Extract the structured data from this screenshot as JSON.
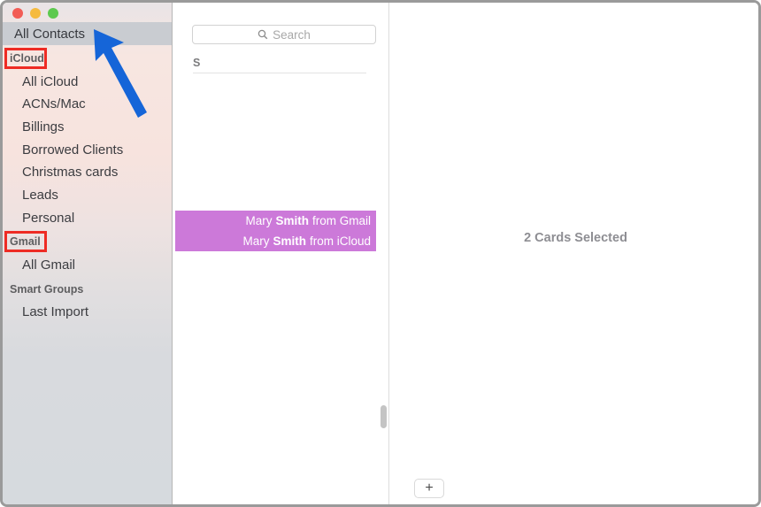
{
  "window": {
    "traffic_lights": [
      {
        "name": "close",
        "color": "#f25c55"
      },
      {
        "name": "minimize",
        "color": "#f5ba3f"
      },
      {
        "name": "zoom",
        "color": "#5ec94f"
      }
    ]
  },
  "sidebar": {
    "all_contacts": {
      "label": "All Contacts",
      "selected": true
    },
    "groups": [
      {
        "header": "iCloud",
        "header_annotated": true,
        "items": [
          {
            "label": "All iCloud"
          },
          {
            "label": "ACNs/Mac"
          },
          {
            "label": "Billings"
          },
          {
            "label": "Borrowed Clients"
          },
          {
            "label": "Christmas cards"
          },
          {
            "label": "Leads"
          },
          {
            "label": "Personal"
          }
        ]
      },
      {
        "header": "Gmail",
        "header_annotated": true,
        "items": [
          {
            "label": "All Gmail"
          }
        ]
      },
      {
        "header": "Smart Groups",
        "header_annotated": false,
        "items": [
          {
            "label": "Last Import"
          }
        ]
      }
    ]
  },
  "list": {
    "search": {
      "placeholder": "Search",
      "value": "",
      "icon": "search-icon"
    },
    "section_header": "S",
    "contacts": [
      {
        "first": "Mary",
        "last": "Smith",
        "suffix": "from Gmail",
        "selected": true
      },
      {
        "first": "Mary",
        "last": "Smith",
        "suffix": "from iCloud",
        "selected": true
      }
    ],
    "selection_color": "#cc79d9"
  },
  "detail": {
    "status_text": "2 Cards Selected",
    "add_button": {
      "label": "+",
      "icon": "plus-icon"
    }
  },
  "annotations": {
    "box_color": "#ee2b24",
    "arrow_color": "#1565d8",
    "arrow_target": "All Contacts"
  }
}
